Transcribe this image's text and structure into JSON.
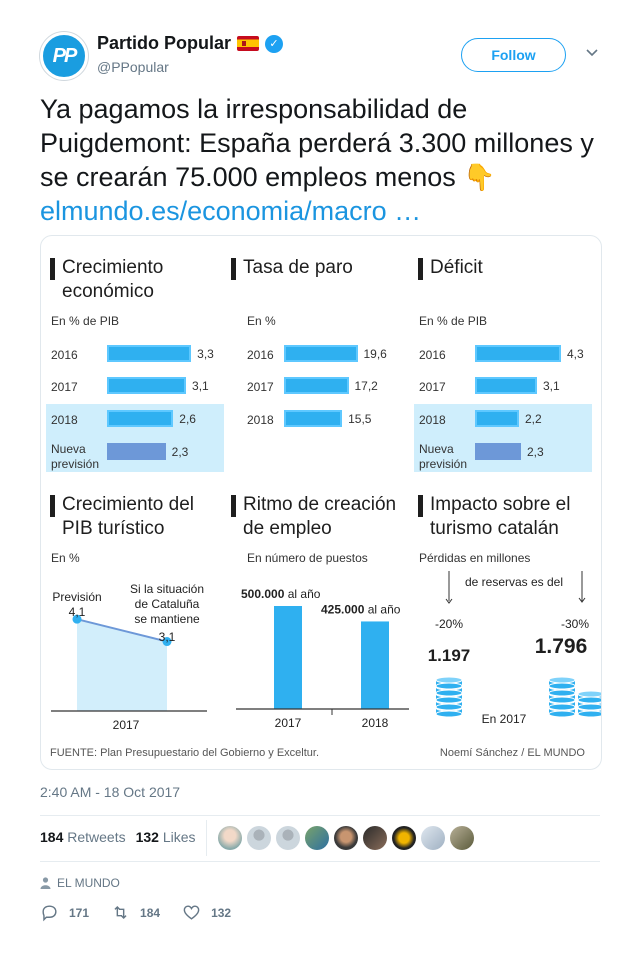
{
  "header": {
    "name": "Partido Popular",
    "handle": "@PPopular",
    "follow_label": "Follow",
    "avatar_text": "PP"
  },
  "tweet": {
    "text": "Ya pagamos la irresponsabilidad de Puigdemont: España perderá 3.300 millones y se crearán 75.000 empleos menos",
    "link": "elmundo.es/economia/macro  …",
    "emoji": "👇"
  },
  "infographic": {
    "sections": {
      "crecimiento": {
        "title": "Crecimiento económico",
        "subtitle": "En % de PIB"
      },
      "paro": {
        "title": "Tasa de paro",
        "subtitle": "En %"
      },
      "deficit": {
        "title": "Déficit",
        "subtitle": "En % de PIB"
      },
      "turistico": {
        "title": "Crecimiento del PIB turístico",
        "subtitle": "En %"
      },
      "empleo": {
        "title": "Ritmo de creación de empleo",
        "subtitle": "En número de puestos"
      },
      "impacto": {
        "title": "Impacto sobre el turismo catalán",
        "subtitle": "Pérdidas en millones"
      }
    },
    "footer_source": "FUENTE: Plan Presupuestario del Gobierno y Exceltur.",
    "footer_author": "Noemí Sánchez / EL MUNDO"
  },
  "chart_data": [
    {
      "type": "bar",
      "title": "Crecimiento económico",
      "unit": "En % de PIB",
      "categories": [
        "2016",
        "2017",
        "2018",
        "Nueva previsión"
      ],
      "values": [
        3.3,
        3.1,
        2.6,
        2.3
      ],
      "labels": [
        "3,3",
        "3,1",
        "2,6",
        "2,3"
      ]
    },
    {
      "type": "bar",
      "title": "Tasa de paro",
      "unit": "En %",
      "categories": [
        "2016",
        "2017",
        "2018"
      ],
      "values": [
        19.6,
        17.2,
        15.5
      ],
      "labels": [
        "19,6",
        "17,2",
        "15,5"
      ]
    },
    {
      "type": "bar",
      "title": "Déficit",
      "unit": "En % de PIB",
      "categories": [
        "2016",
        "2017",
        "2018",
        "Nueva previsión"
      ],
      "values": [
        4.3,
        3.1,
        2.2,
        2.3
      ],
      "labels": [
        "4,3",
        "3,1",
        "2,2",
        "2,3"
      ]
    },
    {
      "type": "area",
      "title": "Crecimiento del PIB turístico",
      "unit": "En %",
      "x": [
        "2017"
      ],
      "points": [
        {
          "label": "Previsión",
          "value": 4.1,
          "value_label": "4,1"
        },
        {
          "label": "Si la situación de Cataluña se mantiene",
          "value": 3.1,
          "value_label": "3,1"
        }
      ]
    },
    {
      "type": "bar",
      "title": "Ritmo de creación de empleo",
      "unit": "En número de puestos",
      "categories": [
        "2017",
        "2018"
      ],
      "values": [
        500000,
        425000
      ],
      "labels": [
        "500.000",
        "425.000"
      ],
      "label_suffix": "al año"
    },
    {
      "type": "table",
      "title": "Impacto sobre el turismo catalán",
      "unit": "Pérdidas en millones",
      "note": "Si la cancelación de reservas es del",
      "year_label": "En 2017",
      "rows": [
        {
          "pct": "-20%",
          "value": 1.197,
          "value_label": "1.197"
        },
        {
          "pct": "-30%",
          "value": 1.796,
          "value_label": "1.796"
        }
      ]
    }
  ],
  "meta": {
    "date": "2:40 AM - 18 Oct 2017",
    "retweets": "184",
    "retweets_label": "Retweets",
    "likes": "132",
    "likes_label": "Likes",
    "source": "EL MUNDO",
    "reply_count": "171",
    "retweet_count": "184",
    "like_count": "132"
  },
  "colors": {
    "accent": "#1da1f2",
    "bar": "#2fb0f0",
    "bar_forecast": "#6d98d8",
    "highlight": "#cfeefc"
  }
}
